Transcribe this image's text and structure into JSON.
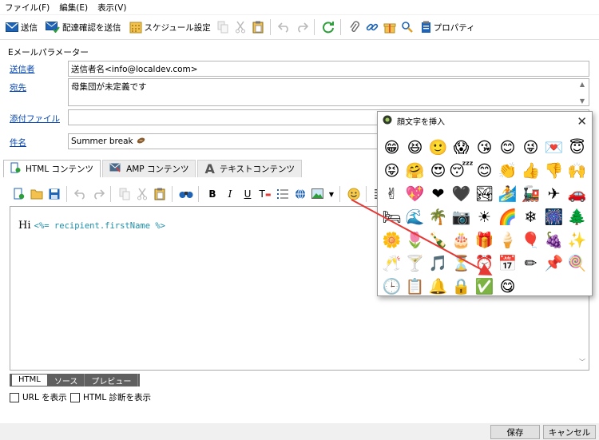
{
  "menu": [
    "ファイル(F)",
    "編集(E)",
    "表示(V)"
  ],
  "toolbar": {
    "send": "送信",
    "send_with_confirmation": "配達確認を送信",
    "schedule_settings": "スケジュール設定",
    "properties": "プロパティ"
  },
  "group_title": "Eメールパラメーター",
  "fields": {
    "sender_label": "送信者",
    "sender_value": "送信者名<info@localdev.com>",
    "recipient_label": "宛先",
    "recipient_value": "母集団が未定義です",
    "attachment_label": "添付ファイル",
    "attachment_value": "",
    "subject_label": "件名",
    "subject_value": "Summer break"
  },
  "content_tabs": [
    "HTML コンテンツ",
    "AMP コンテンツ",
    "テキストコンテンツ"
  ],
  "editor": {
    "text_hi": "Hi ",
    "personalization": "<%= recipient.firstName %>"
  },
  "bottom_tabs": [
    "HTML",
    "ソース",
    "プレビュー"
  ],
  "checkboxes": {
    "show_urls": "URL を表示",
    "show_html_diagnostics": "HTML 診断を表示"
  },
  "buttons": {
    "save": "保存",
    "cancel": "キャンセル"
  },
  "emoji_panel": {
    "title": "顔文字を挿入",
    "emojis": [
      "😁",
      "😆",
      "🙂",
      "😱",
      "😘",
      "😊",
      "😜",
      "💌",
      "😇",
      "😝",
      "🤗",
      "😍",
      "😴",
      "😊",
      "👏",
      "👍",
      "👎",
      "🙌",
      "✌",
      "💖",
      "❤",
      "🖤",
      "🏞",
      "🏄",
      "🚂",
      "✈",
      "🚗",
      "🛏",
      "🌊",
      "🌴",
      "📷",
      "☀",
      "🌈",
      "❄",
      "🎆",
      "🌲",
      "🌼",
      "🌷",
      "🍾",
      "🎂",
      "🎁",
      "🍦",
      "🎈",
      "🍇",
      "✨",
      "🥂",
      "🍸",
      "🎵",
      "⏳",
      "⏰",
      "📅",
      "✏",
      "📌",
      "🍭",
      "🕒",
      "📋",
      "🔔",
      "🔒",
      "✅",
      "😋"
    ]
  },
  "colors": {
    "link": "#0645ad",
    "personalization": "#1f8ea8",
    "arrow": "#e53935",
    "send_icon": "#1e63b5",
    "refresh_icon": "#2e9e3b"
  }
}
